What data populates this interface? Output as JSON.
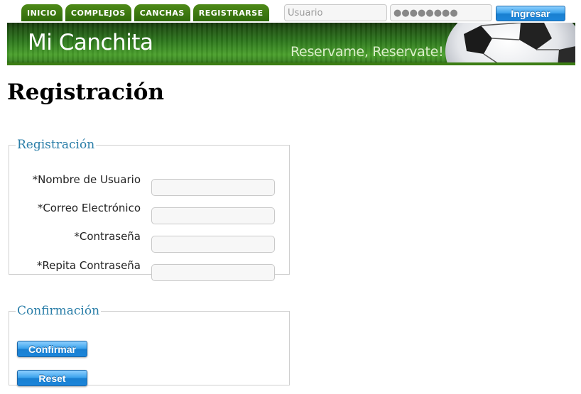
{
  "nav": {
    "tabs": [
      {
        "label": "INICIO"
      },
      {
        "label": "COMPLEJOS"
      },
      {
        "label": "CANCHAS"
      },
      {
        "label": "REGISTRARSE"
      }
    ]
  },
  "login": {
    "user_placeholder": "Usuario",
    "password_value": "●●●●●●●●",
    "button_label": "Ingresar"
  },
  "banner": {
    "site_title": "Mi Canchita",
    "slogan": "Reservame, Reservate!",
    "icon": "soccer-ball-icon"
  },
  "page": {
    "title": "Registración"
  },
  "registration": {
    "legend": "Registración",
    "fields": [
      {
        "label": "*Nombre de Usuario",
        "value": ""
      },
      {
        "label": "*Correo Electrónico",
        "value": ""
      },
      {
        "label": "*Contraseña",
        "value": ""
      },
      {
        "label": "*Repita Contraseña",
        "value": ""
      }
    ]
  },
  "confirmation": {
    "legend": "Confirmación",
    "confirm_label": "Confirmar",
    "reset_label": "Reset"
  },
  "colors": {
    "nav_tab": "#3a7610",
    "banner_green": "#2f7a1e",
    "legend_blue": "#2a7ea8",
    "button_blue": "#1f86d6"
  }
}
